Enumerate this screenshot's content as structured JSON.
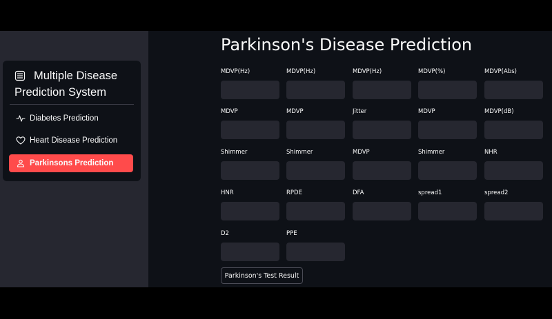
{
  "sidebar": {
    "title": "Multiple Disease Prediction System",
    "title_icon": "menu-list-icon",
    "items": [
      {
        "label": "Diabetes Prediction",
        "icon": "activity-icon",
        "active": false
      },
      {
        "label": "Heart Disease Prediction",
        "icon": "heart-icon",
        "active": false
      },
      {
        "label": "Parkinsons Prediction",
        "icon": "person-icon",
        "active": true
      }
    ]
  },
  "main": {
    "title": "Parkinson's Disease Prediction",
    "fields": [
      {
        "label": "MDVP(Hz)",
        "value": ""
      },
      {
        "label": "MDVP(Hz)",
        "value": ""
      },
      {
        "label": "MDVP(Hz)",
        "value": ""
      },
      {
        "label": "MDVP(%)",
        "value": ""
      },
      {
        "label": "MDVP(Abs)",
        "value": ""
      },
      {
        "label": "MDVP",
        "value": ""
      },
      {
        "label": "MDVP",
        "value": ""
      },
      {
        "label": "Jitter",
        "value": ""
      },
      {
        "label": "MDVP",
        "value": ""
      },
      {
        "label": "MDVP(dB)",
        "value": ""
      },
      {
        "label": "Shimmer",
        "value": ""
      },
      {
        "label": "Shimmer",
        "value": ""
      },
      {
        "label": "MDVP",
        "value": ""
      },
      {
        "label": "Shimmer",
        "value": ""
      },
      {
        "label": "NHR",
        "value": ""
      },
      {
        "label": "HNR",
        "value": ""
      },
      {
        "label": "RPDE",
        "value": ""
      },
      {
        "label": "DFA",
        "value": ""
      },
      {
        "label": "spread1",
        "value": ""
      },
      {
        "label": "spread2",
        "value": ""
      },
      {
        "label": "D2",
        "value": ""
      },
      {
        "label": "PPE",
        "value": ""
      }
    ],
    "button_label": "Parkinson's Test Result"
  },
  "colors": {
    "app_background": "#0e1117",
    "sidebar_background": "#262730",
    "input_background": "#262730",
    "accent": "#ff4b4b",
    "text": "#fafafa"
  }
}
